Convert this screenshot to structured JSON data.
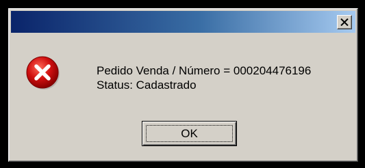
{
  "dialog": {
    "title": "",
    "message_line1": "Pedido Venda / Número = 000204476196",
    "message_line2": "Status: Cadastrado",
    "ok_label": "OK"
  },
  "icons": {
    "close": "close-icon",
    "error": "error-icon"
  },
  "colors": {
    "titlebar_start": "#0a246a",
    "titlebar_end": "#a6caf0",
    "dialog_face": "#d4d0c8",
    "error_red": "#d01010"
  }
}
